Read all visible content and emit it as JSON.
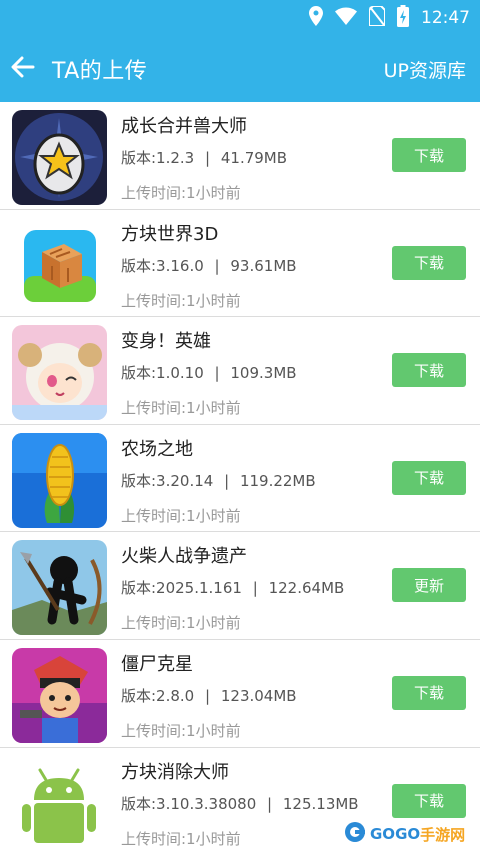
{
  "status": {
    "time": "12:47"
  },
  "header": {
    "back_icon": "arrow-left-icon",
    "title": "TA的上传",
    "right_link": "UP资源库"
  },
  "items": [
    {
      "name": "成长合并兽大师",
      "version": "版本:1.2.3",
      "size": "41.79MB",
      "upload_time": "上传时间:1小时前",
      "button": "下载"
    },
    {
      "name": "方块世界3D",
      "version": "版本:3.16.0",
      "size": "93.61MB",
      "upload_time": "上传时间:1小时前",
      "button": "下载"
    },
    {
      "name": "变身！英雄",
      "version": "版本:1.0.10",
      "size": "109.3MB",
      "upload_time": "上传时间:1小时前",
      "button": "下载"
    },
    {
      "name": "农场之地",
      "version": "版本:3.20.14",
      "size": "119.22MB",
      "upload_time": "上传时间:1小时前",
      "button": "下载"
    },
    {
      "name": "火柴人战争遗产",
      "version": "版本:2025.1.161",
      "size": "122.64MB",
      "upload_time": "上传时间:1小时前",
      "button": "更新"
    },
    {
      "name": "僵尸克星",
      "version": "版本:2.8.0",
      "size": "123.04MB",
      "upload_time": "上传时间:1小时前",
      "button": "下载"
    },
    {
      "name": "方块消除大师",
      "version": "版本:3.10.3.38080",
      "size": "125.13MB",
      "upload_time": "上传时间:1小时前",
      "button": "下载"
    }
  ],
  "separator": "|",
  "watermark": {
    "part1": "GOGO",
    "part2": "手游网"
  },
  "colors": {
    "header": "#33b3e8",
    "button": "#62c86f"
  }
}
